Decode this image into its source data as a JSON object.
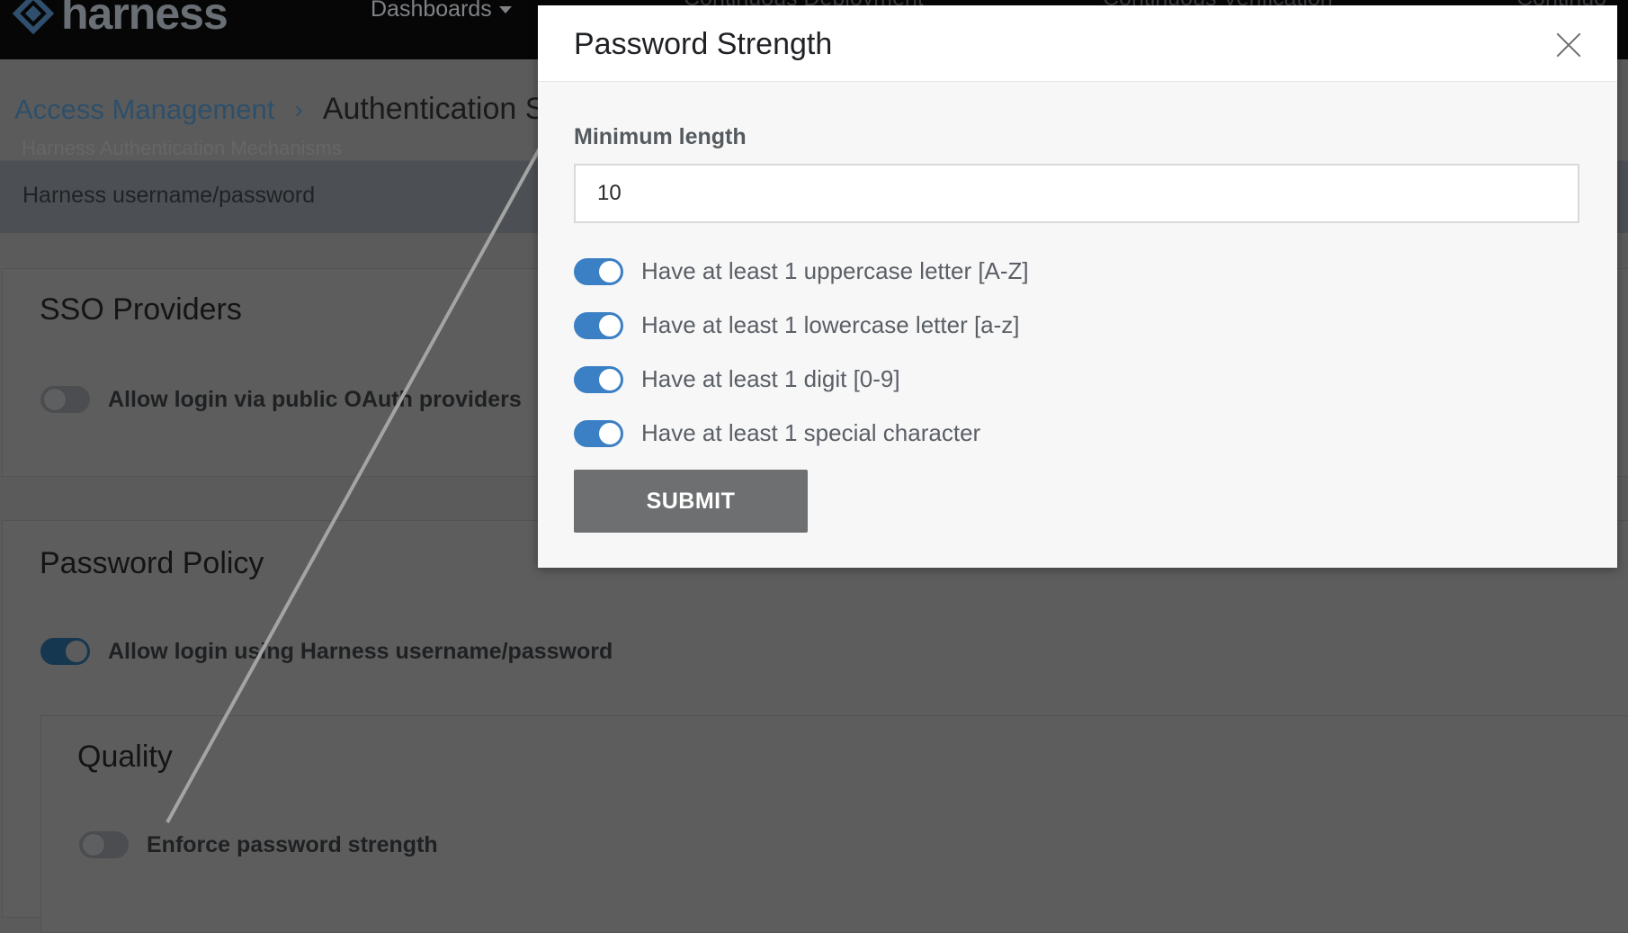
{
  "nav": {
    "logo_text": "harness",
    "dashboards": "Dashboards",
    "ghost_items": [
      "Continuous Deployment",
      "Continuous Verification",
      "Continuo"
    ]
  },
  "breadcrumb": {
    "parent": "Access Management",
    "current": "Authentication S"
  },
  "page": {
    "ghost_line": "Harness Authentication Mechanisms",
    "method_value": "Harness username/password",
    "sso": {
      "title": "SSO Providers",
      "oauth_label": "Allow login via public OAuth providers",
      "oauth_enabled": false
    },
    "password_policy": {
      "title": "Password Policy",
      "harness_login_label": "Allow login using Harness username/password",
      "harness_login_enabled": true,
      "quality": {
        "title": "Quality",
        "enforce_label": "Enforce password strength",
        "enforce_enabled": false
      }
    }
  },
  "modal": {
    "title": "Password Strength",
    "min_length_label": "Minimum length",
    "min_length_value": "10",
    "rules": [
      {
        "label": "Have at least 1 uppercase letter [A-Z]",
        "enabled": true
      },
      {
        "label": "Have at least 1 lowercase letter [a-z]",
        "enabled": true
      },
      {
        "label": "Have at least 1 digit [0-9]",
        "enabled": true
      },
      {
        "label": "Have at least 1 special character",
        "enabled": true
      }
    ],
    "submit_label": "SUBMIT"
  },
  "colors": {
    "accent": "#3b7fc4",
    "overlay_bg": "#5b5b5b",
    "submit_bg": "#6e6f71"
  }
}
